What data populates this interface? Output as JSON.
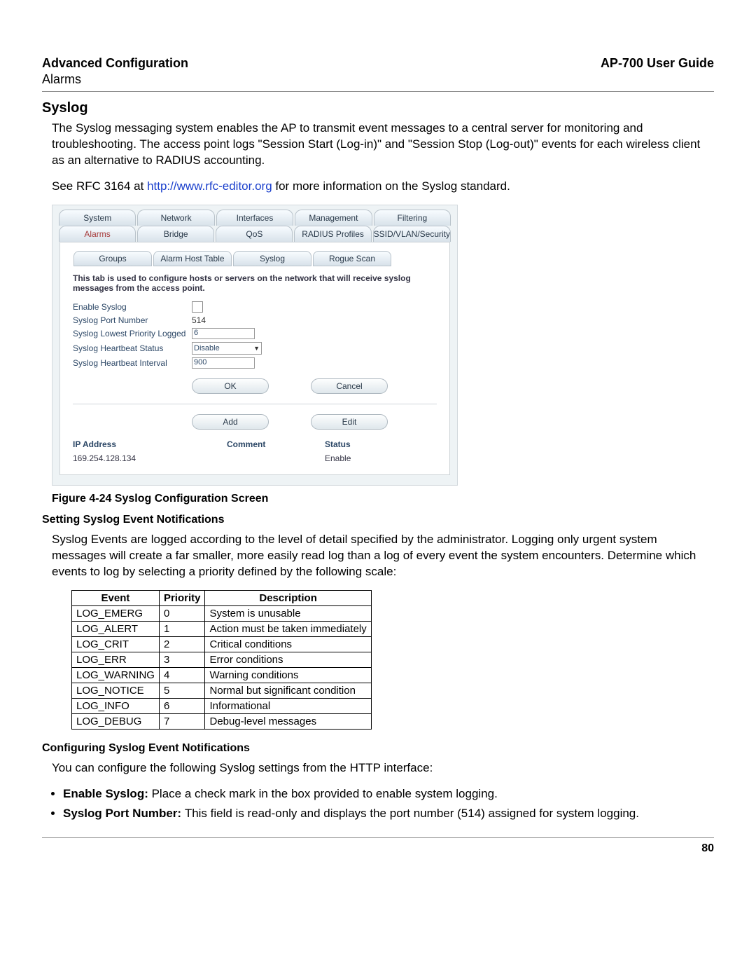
{
  "header": {
    "left": "Advanced Configuration",
    "right": "AP-700 User Guide",
    "sub": "Alarms"
  },
  "section": {
    "title": "Syslog"
  },
  "para1": "The Syslog messaging system enables the AP to transmit event messages to a central server for monitoring and troubleshooting. The access point logs \"Session Start (Log-in)\" and \"Session Stop (Log-out)\" events for each wireless client as an alternative to RADIUS accounting.",
  "para2_pre": "See RFC 3164 at ",
  "para2_link": "http://www.rfc-editor.org",
  "para2_post": " for more information on the Syslog standard.",
  "screenshot": {
    "topTabs": [
      "System",
      "Network",
      "Interfaces",
      "Management",
      "Filtering"
    ],
    "topTabs2": [
      "Alarms",
      "Bridge",
      "QoS",
      "RADIUS Profiles",
      "SSID/VLAN/Security"
    ],
    "subTabs": [
      "Groups",
      "Alarm Host Table",
      "Syslog",
      "Rogue Scan"
    ],
    "descText": "This tab is used to configure hosts or servers on the network that will receive syslog messages from the access point.",
    "form": {
      "enableLabel": "Enable Syslog",
      "portLabel": "Syslog Port Number",
      "portValue": "514",
      "prioLabel": "Syslog Lowest Priority Logged",
      "prioValue": "6",
      "hbStatusLabel": "Syslog Heartbeat Status",
      "hbStatusValue": "Disable",
      "hbIntLabel": "Syslog Heartbeat Interval",
      "hbIntValue": "900"
    },
    "buttons": {
      "ok": "OK",
      "cancel": "Cancel",
      "add": "Add",
      "edit": "Edit"
    },
    "hostHeaders": {
      "ip": "IP Address",
      "comment": "Comment",
      "status": "Status"
    },
    "hostRow": {
      "ip": "169.254.128.134",
      "comment": "",
      "status": "Enable"
    }
  },
  "figCaption": "Figure 4-24 Syslog Configuration Screen",
  "subhead1": "Setting Syslog Event Notifications",
  "para3": "Syslog Events are logged according to the level of detail specified by the administrator. Logging only urgent system messages will create a far smaller, more easily read log than a log of every event the system encounters. Determine which events to log by selecting a priority defined by the following scale:",
  "priTable": {
    "headers": [
      "Event",
      "Priority",
      "Description"
    ],
    "rows": [
      [
        "LOG_EMERG",
        "0",
        "System is unusable"
      ],
      [
        "LOG_ALERT",
        "1",
        "Action must be taken immediately"
      ],
      [
        "LOG_CRIT",
        "2",
        "Critical conditions"
      ],
      [
        "LOG_ERR",
        "3",
        "Error conditions"
      ],
      [
        "LOG_WARNING",
        "4",
        "Warning conditions"
      ],
      [
        "LOG_NOTICE",
        "5",
        "Normal but significant condition"
      ],
      [
        "LOG_INFO",
        "6",
        "Informational"
      ],
      [
        "LOG_DEBUG",
        "7",
        "Debug-level messages"
      ]
    ]
  },
  "subhead2": "Configuring Syslog Event Notifications",
  "para4": "You can configure the following Syslog settings from the HTTP interface:",
  "bullets": [
    {
      "bold": "Enable Syslog: ",
      "rest": "Place a check mark in the box provided to enable system logging."
    },
    {
      "bold": "Syslog Port Number: ",
      "rest": "This field is read-only and displays the port number (514) assigned for system logging."
    }
  ],
  "pageNum": "80"
}
